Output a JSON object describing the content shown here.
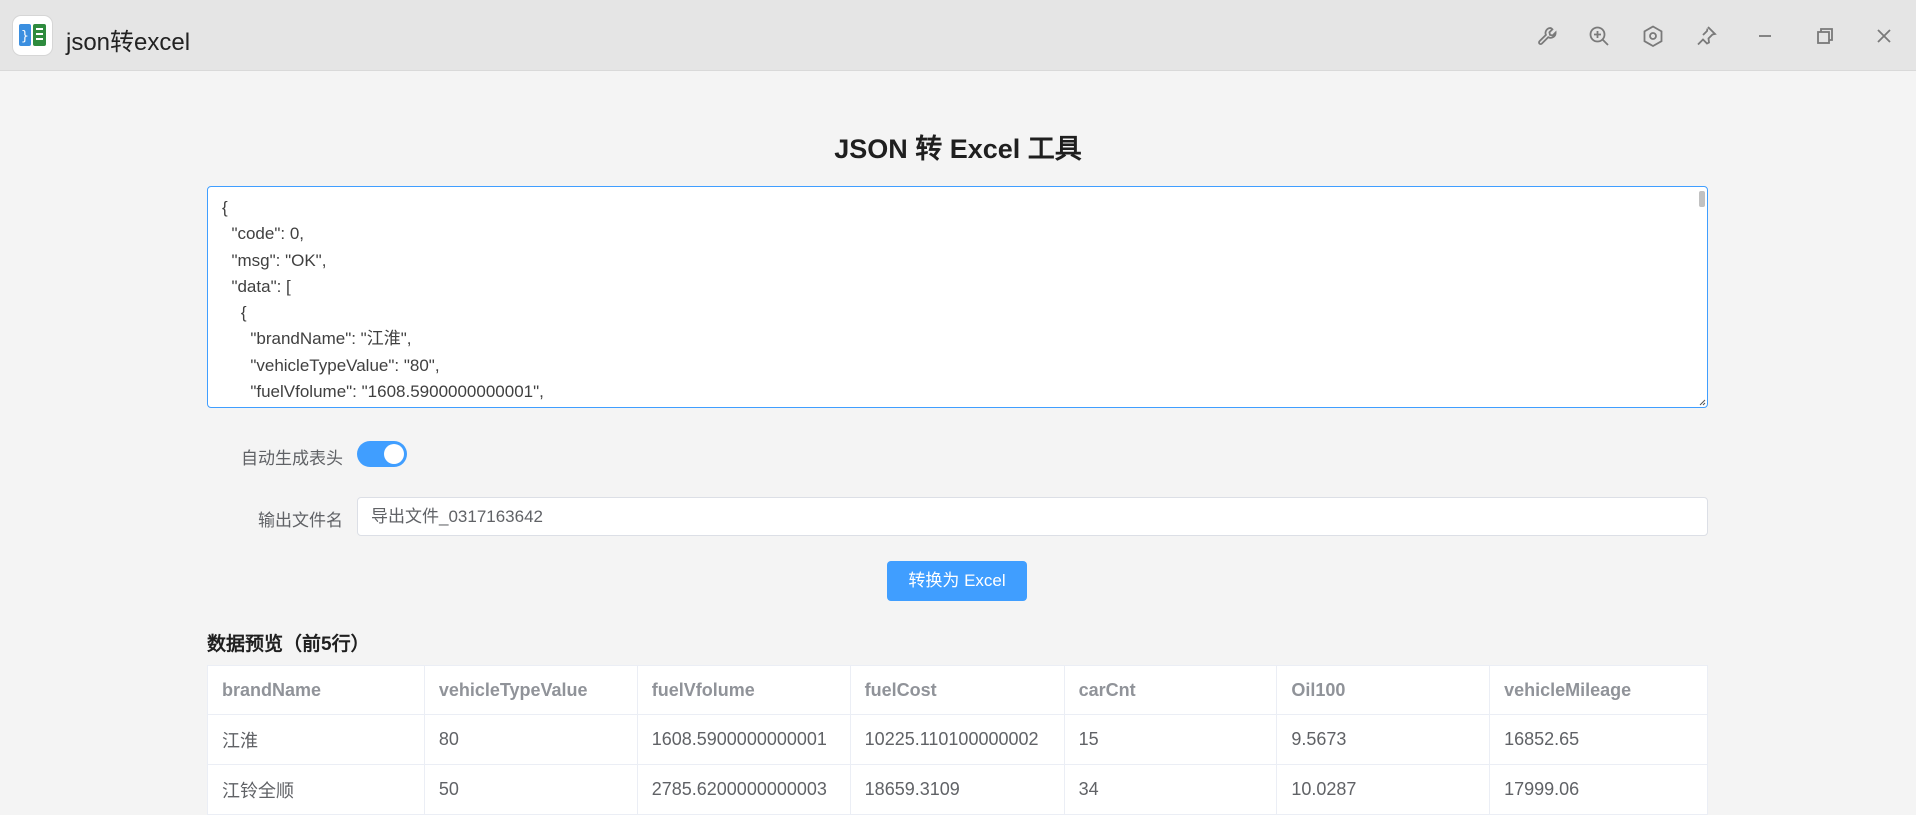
{
  "window": {
    "title": "json转excel",
    "icons": [
      "wrench-icon",
      "zoom-in-icon",
      "settings-hex-icon",
      "pin-icon",
      "minimize-icon",
      "restore-icon",
      "close-icon"
    ]
  },
  "main": {
    "title": "JSON 转 Excel 工具",
    "json_input": "{\n  \"code\": 0,\n  \"msg\": \"OK\",\n  \"data\": [\n    {\n      \"brandName\": \"江淮\",\n      \"vehicleTypeValue\": \"80\",\n      \"fuelVfolume\": \"1608.5900000000001\",",
    "auto_header_label": "自动生成表头",
    "auto_header_enabled": true,
    "filename_label": "输出文件名",
    "filename_value": "导出文件_0317163642",
    "convert_button": "转换为 Excel",
    "preview_title": "数据预览（前5行）"
  },
  "table": {
    "headers": [
      "brandName",
      "vehicleTypeValue",
      "fuelVfolume",
      "fuelCost",
      "carCnt",
      "Oil100",
      "vehicleMileage"
    ],
    "rows": [
      [
        "江淮",
        "80",
        "1608.5900000000001",
        "10225.110100000002",
        "15",
        "9.5673",
        "16852.65"
      ],
      [
        "江铃全顺",
        "50",
        "2785.6200000000003",
        "18659.3109",
        "34",
        "10.0287",
        "17999.06"
      ]
    ]
  },
  "colors": {
    "accent": "#409eff",
    "titlebar": "#e5e5e5",
    "background": "#f4f4f4"
  }
}
